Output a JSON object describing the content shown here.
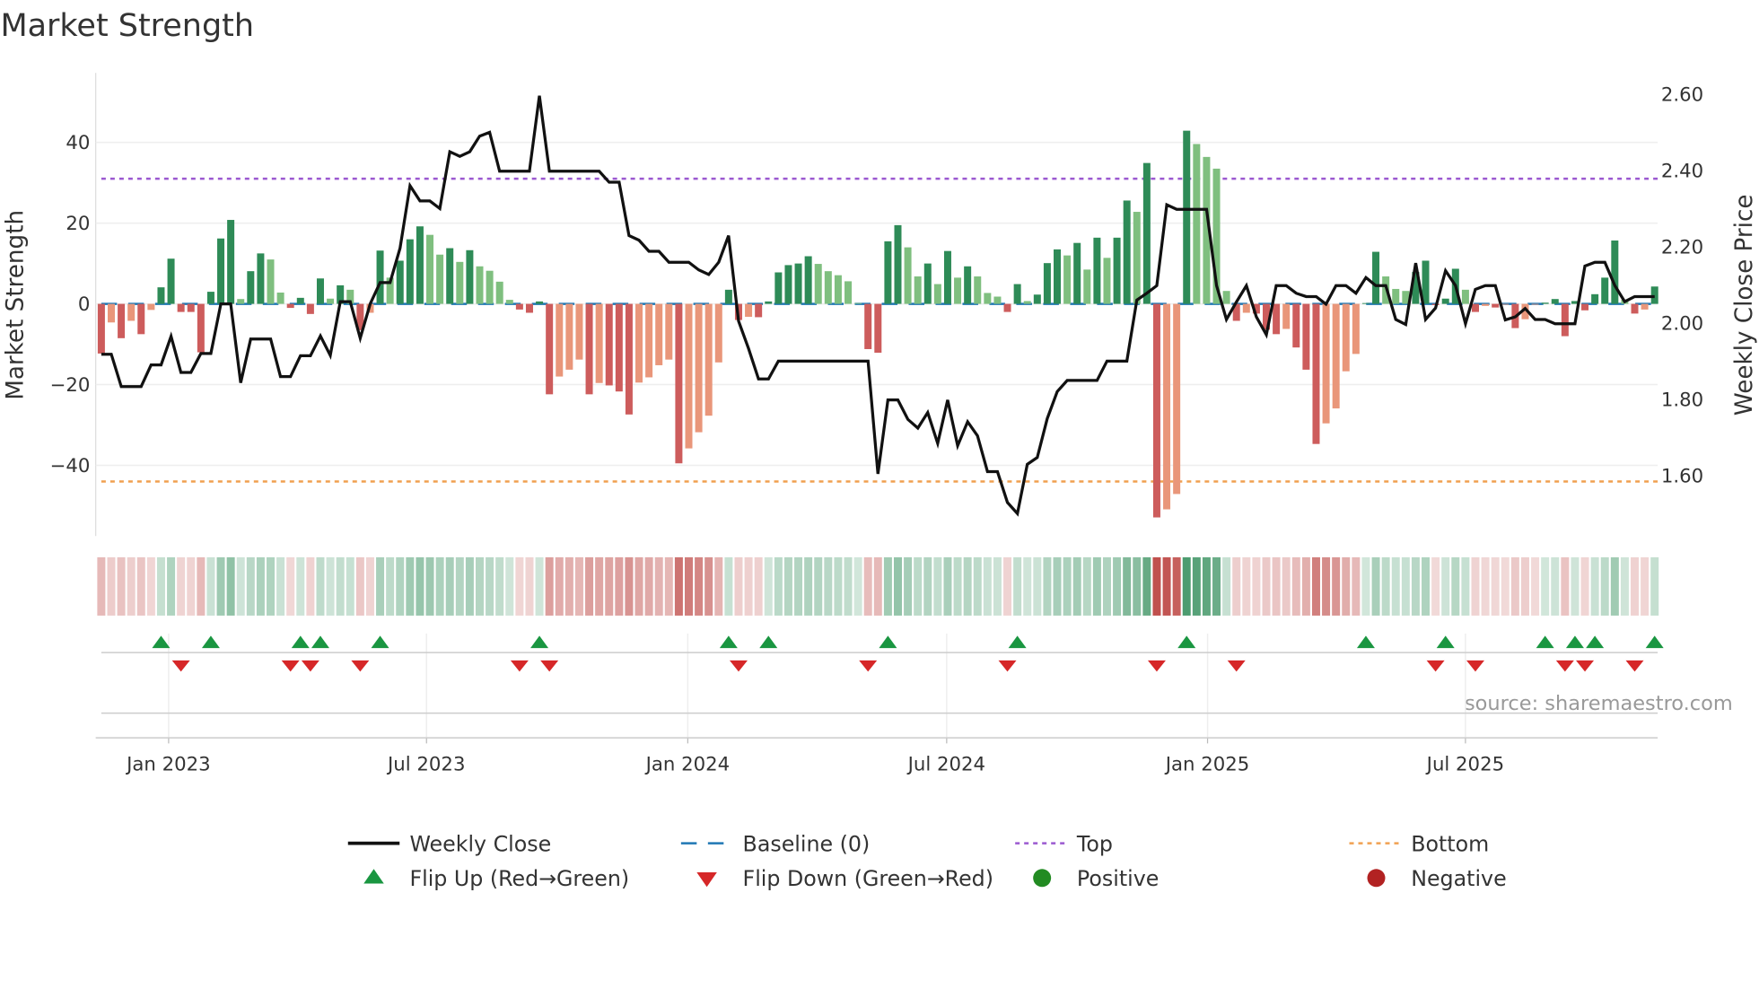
{
  "title": "Market Strength",
  "source": "source: sharemaestro.com",
  "chart_data": {
    "type": "bar",
    "title": "Market Strength",
    "ylabel": "Market Strength",
    "y2label": "Weekly Close Price",
    "xlabel": "",
    "frequency": "weekly",
    "ylim": [
      -57,
      57
    ],
    "y2lim": [
      1.45,
      2.65
    ],
    "y_ticks": [
      {
        "value": 40,
        "label": "40"
      },
      {
        "value": 20,
        "label": "20"
      },
      {
        "value": 0,
        "label": "0"
      },
      {
        "value": -20,
        "label": "−20"
      },
      {
        "value": -40,
        "label": "−40"
      }
    ],
    "y2_ticks": [
      {
        "value": 2.6,
        "label": "2.60"
      },
      {
        "value": 2.4,
        "label": "2.40"
      },
      {
        "value": 2.2,
        "label": "2.20"
      },
      {
        "value": 2.0,
        "label": "2.00"
      },
      {
        "value": 1.8,
        "label": "1.80"
      },
      {
        "value": 1.6,
        "label": "1.60"
      }
    ],
    "x_ticks": [
      {
        "week_index": 6.76,
        "label": "Jan 2023"
      },
      {
        "week_index": 32.66,
        "label": "Jul 2023"
      },
      {
        "week_index": 58.9,
        "label": "Jan 2024"
      },
      {
        "week_index": 84.9,
        "label": "Jul 2024"
      },
      {
        "week_index": 111.1,
        "label": "Jan 2025"
      },
      {
        "week_index": 137.0,
        "label": "Jul 2025"
      }
    ],
    "thresholds": {
      "top": 31,
      "bottom": -44,
      "baseline": 0
    },
    "strength": [
      -12.3,
      -4.6,
      -8.5,
      -4.2,
      -7.5,
      -1.5,
      4.1,
      11.2,
      -2,
      -2,
      -12,
      3,
      16.2,
      20.8,
      1.2,
      8.1,
      12.5,
      11,
      2.8,
      -1,
      1.5,
      -2.5,
      6.3,
      1.3,
      4.6,
      3.5,
      -6.5,
      -2.2,
      13.2,
      6.5,
      10.7,
      16,
      19.2,
      17.1,
      12.2,
      13.8,
      10.4,
      13.3,
      9.3,
      8.2,
      5.5,
      1,
      -1.4,
      -2.2,
      0.6,
      -22.4,
      -18,
      -16.3,
      -13.8,
      -22.4,
      -19.6,
      -20.2,
      -21.7,
      -27.4,
      -19.5,
      -18.2,
      -15.2,
      -13.8,
      -39.5,
      -35.8,
      -31.8,
      -27.7,
      -14.5,
      3.5,
      -4,
      -3.2,
      -3.3,
      0.6,
      7.8,
      9.6,
      10,
      11.8,
      9.9,
      8.1,
      7.1,
      5.6,
      0.2,
      -11.2,
      -12.1,
      15.5,
      19.5,
      14,
      6.8,
      10,
      4.9,
      13.1,
      6.5,
      9.3,
      6.8,
      2.7,
      1.8,
      -2,
      4.9,
      0.7,
      2.3,
      10.1,
      13.5,
      12,
      15.1,
      8.5,
      16.4,
      11.4,
      16.4,
      25.6,
      22.8,
      34.9,
      -52.9,
      -50.9,
      -47.1,
      42.9,
      39.6,
      36.4,
      33.5,
      3.2,
      -4.2,
      -2.2,
      -2.4,
      -6.4,
      -7.5,
      -6.2,
      -10.8,
      -16.3,
      -34.7,
      -29.6,
      -25.9,
      -16.7,
      -12.4,
      0.2,
      12.9,
      6.8,
      3.7,
      3.2,
      7.9,
      10.7,
      -0.3,
      1.3,
      8.7,
      3.5,
      -2,
      -0.5,
      -0.9,
      -0.2,
      -6,
      -3.8,
      -0.2,
      0.3,
      1.2,
      -8,
      0.7,
      -1.6,
      2.4,
      6.5,
      15.7,
      1,
      -2.4,
      -1.4,
      4.3
    ],
    "weekly_close": [
      1.918,
      1.918,
      1.833,
      1.833,
      1.833,
      1.89,
      1.89,
      1.965,
      1.87,
      1.87,
      1.92,
      1.92,
      2.05,
      2.05,
      1.843,
      1.958,
      1.958,
      1.958,
      1.859,
      1.859,
      1.914,
      1.914,
      1.966,
      1.915,
      2.056,
      2.056,
      1.96,
      2.05,
      2.106,
      2.106,
      2.196,
      2.36,
      2.32,
      2.32,
      2.3,
      2.449,
      2.437,
      2.449,
      2.49,
      2.5,
      2.398,
      2.398,
      2.398,
      2.398,
      2.596,
      2.398,
      2.398,
      2.398,
      2.398,
      2.398,
      2.398,
      2.369,
      2.369,
      2.229,
      2.217,
      2.188,
      2.188,
      2.159,
      2.159,
      2.159,
      2.139,
      2.127,
      2.159,
      2.229,
      2.005,
      1.933,
      1.853,
      1.853,
      1.9,
      1.9,
      1.9,
      1.9,
      1.9,
      1.9,
      1.9,
      1.9,
      1.9,
      1.9,
      1.604,
      1.798,
      1.798,
      1.747,
      1.724,
      1.765,
      1.684,
      1.798,
      1.678,
      1.741,
      1.704,
      1.61,
      1.61,
      1.529,
      1.5,
      1.629,
      1.647,
      1.749,
      1.82,
      1.849,
      1.849,
      1.849,
      1.849,
      1.9,
      1.9,
      1.9,
      2.06,
      2.078,
      2.098,
      2.31,
      2.298,
      2.298,
      2.298,
      2.298,
      2.098,
      2.009,
      2.055,
      2.098,
      2.016,
      1.969,
      2.098,
      2.098,
      2.078,
      2.069,
      2.069,
      2.049,
      2.098,
      2.098,
      2.078,
      2.119,
      2.098,
      2.098,
      2.009,
      1.996,
      2.157,
      2.009,
      2.039,
      2.137,
      2.098,
      1.998,
      2.088,
      2.098,
      2.098,
      2.008,
      2.016,
      2.038,
      2.009,
      2.009,
      1.998,
      1.998,
      1.998,
      2.149,
      2.159,
      2.159,
      2.098,
      2.056,
      2.069,
      2.069,
      2.069
    ],
    "legend": {
      "placement": "bottom",
      "entries": [
        {
          "label": "Weekly Close",
          "kind": "line",
          "color": "#111111"
        },
        {
          "label": "Baseline (0)",
          "kind": "dashed",
          "color": "#1f77b4"
        },
        {
          "label": "Top",
          "kind": "dotted",
          "color": "#9b59d0"
        },
        {
          "label": "Bottom",
          "kind": "dotted",
          "color": "#f0a050"
        },
        {
          "label": "Flip Up (Red→Green)",
          "kind": "triangle-up",
          "color": "#1a9641"
        },
        {
          "label": "Flip Down (Green→Red)",
          "kind": "triangle-down",
          "color": "#d62728"
        },
        {
          "label": "Positive",
          "kind": "circle",
          "color": "#228b22"
        },
        {
          "label": "Negative",
          "kind": "circle",
          "color": "#b22222"
        }
      ]
    },
    "colors": {
      "pos_rising": "#2e8b57",
      "pos_falling": "#7fbf7f",
      "neg_falling": "#cd5c5c",
      "neg_rising": "#e9967a",
      "heat_pos": "#2e8b57",
      "heat_neg": "#c0504d",
      "grid": "#eeeeee"
    }
  }
}
